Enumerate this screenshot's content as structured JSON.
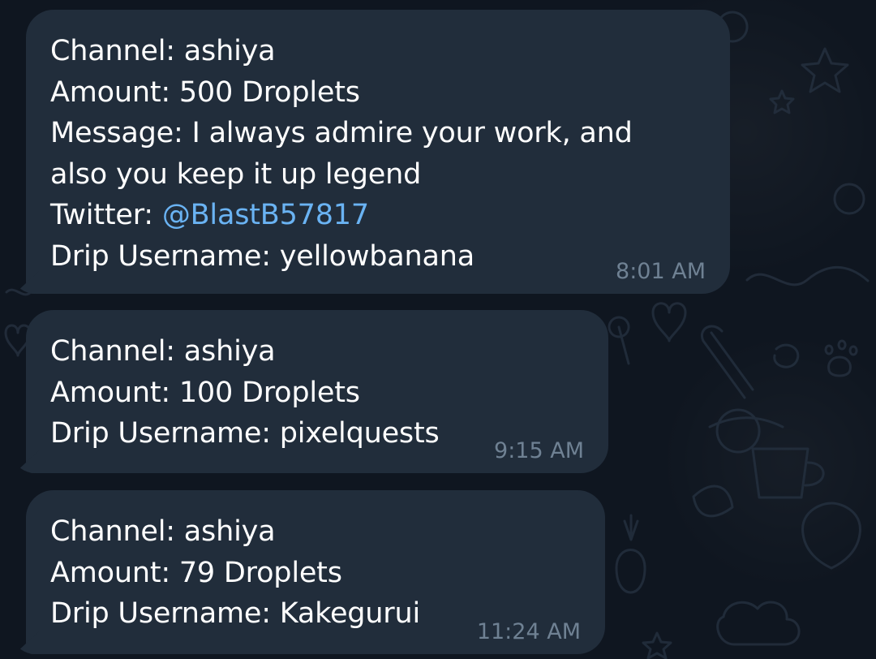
{
  "messages": [
    {
      "channel": "Channel: ashiya",
      "amount": "Amount: 500 Droplets",
      "message_prefix": "Message: I always admire your work, and",
      "message_suffix": "also you keep it up legend",
      "twitter_label": "Twitter: ",
      "twitter_handle": "@BlastB57817",
      "username": "Drip Username: yellowbanana",
      "time": "8:01 AM"
    },
    {
      "channel": "Channel: ashiya",
      "amount": "Amount: 100 Droplets",
      "username": "Drip Username: pixelquests",
      "time": "9:15 AM"
    },
    {
      "channel": "Channel: ashiya",
      "amount": "Amount: 79 Droplets",
      "username": "Drip Username: Kakegurui",
      "time": "11:24 AM"
    }
  ],
  "colors": {
    "background": "#0f1620",
    "bubble": "#212d3b",
    "text": "#ffffff",
    "timestamp": "#6f8193",
    "link": "#6ab3f3"
  }
}
